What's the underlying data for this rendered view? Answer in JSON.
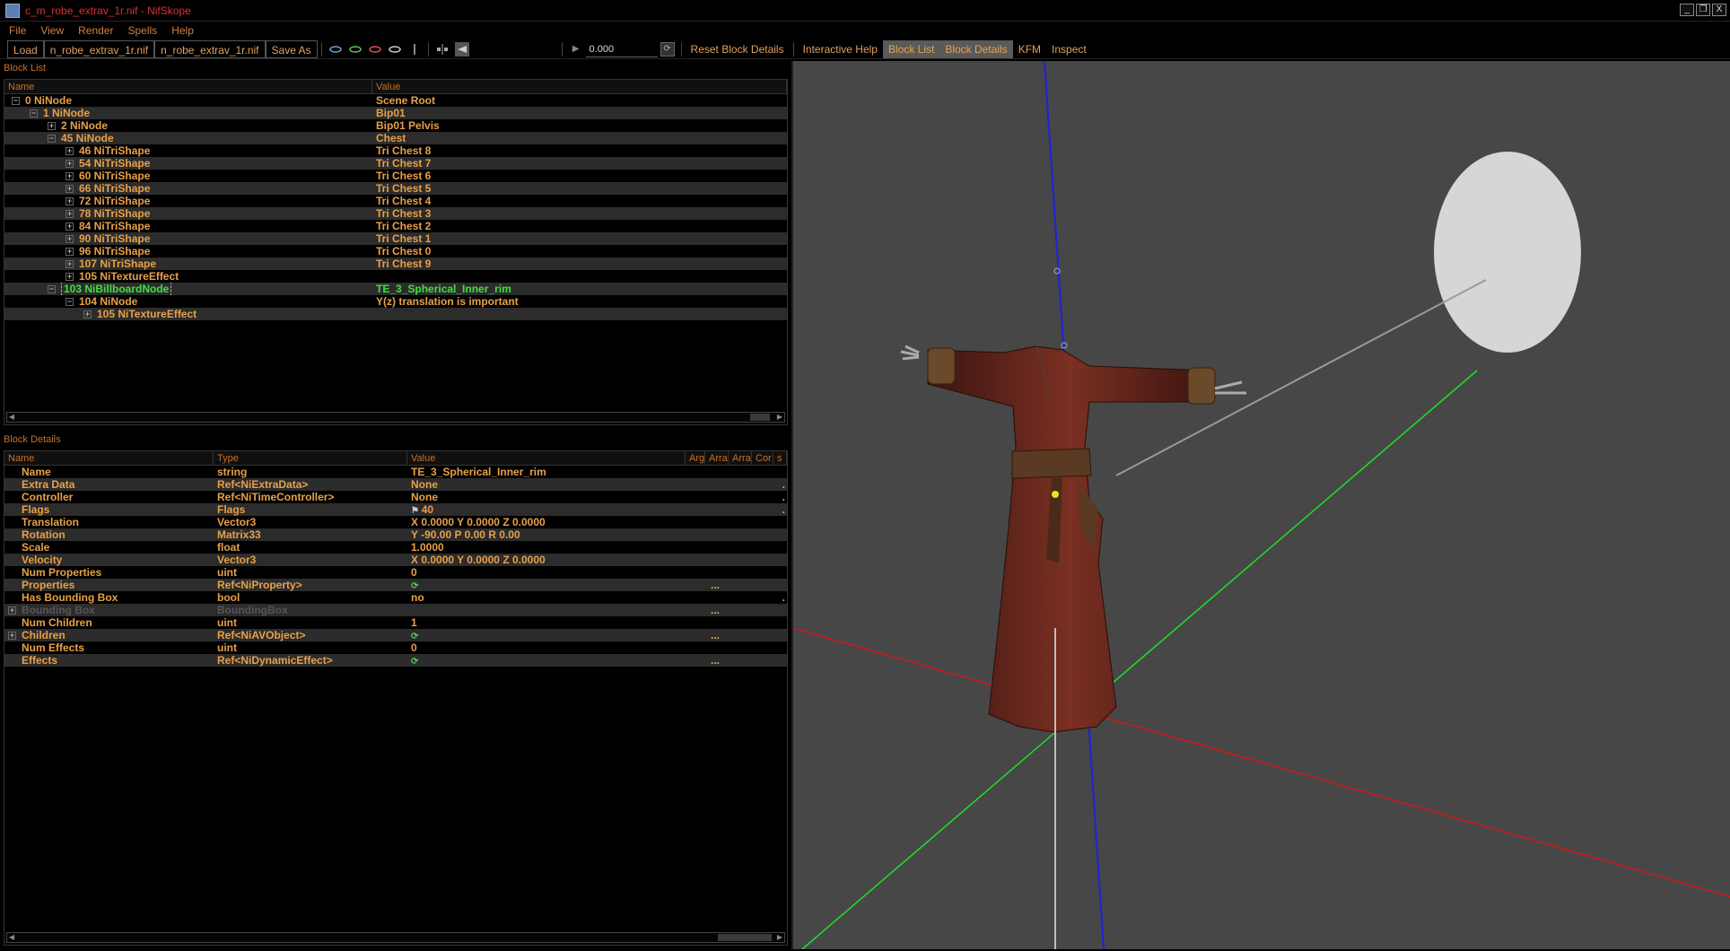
{
  "window": {
    "title": "c_m_robe_extrav_1r.nif - NifSkope",
    "min_label": "_",
    "max_label": "❐",
    "close_label": "X"
  },
  "menu": [
    "File",
    "View",
    "Render",
    "Spells",
    "Help"
  ],
  "toolbar": {
    "load": "Load",
    "load_file": "n_robe_extrav_1r.nif",
    "save_file": "n_robe_extrav_1r.nif",
    "save_as": "Save As",
    "time_value": "0.000",
    "reset_block_details": "Reset Block Details",
    "interactive_help": "Interactive Help",
    "block_list": "Block List",
    "block_details": "Block Details",
    "kfm": "KFM",
    "inspect": "Inspect"
  },
  "block_list": {
    "title": "Block List",
    "col_name": "Name",
    "col_value": "Value",
    "rows": [
      {
        "name": "0 NiNode",
        "value": "Scene Root",
        "depth": 0,
        "exp": "−"
      },
      {
        "name": "1 NiNode",
        "value": "Bip01",
        "depth": 1,
        "exp": "−"
      },
      {
        "name": "2 NiNode",
        "value": "Bip01 Pelvis",
        "depth": 2,
        "exp": "+"
      },
      {
        "name": "45 NiNode",
        "value": "Chest",
        "depth": 2,
        "exp": "−"
      },
      {
        "name": "46 NiTriShape",
        "value": "Tri Chest 8",
        "depth": 3,
        "exp": "+"
      },
      {
        "name": "54 NiTriShape",
        "value": "Tri Chest 7",
        "depth": 3,
        "exp": "+"
      },
      {
        "name": "60 NiTriShape",
        "value": "Tri Chest 6",
        "depth": 3,
        "exp": "+"
      },
      {
        "name": "66 NiTriShape",
        "value": "Tri Chest 5",
        "depth": 3,
        "exp": "+"
      },
      {
        "name": "72 NiTriShape",
        "value": "Tri Chest 4",
        "depth": 3,
        "exp": "+"
      },
      {
        "name": "78 NiTriShape",
        "value": "Tri Chest 3",
        "depth": 3,
        "exp": "+"
      },
      {
        "name": "84 NiTriShape",
        "value": "Tri Chest 2",
        "depth": 3,
        "exp": "+"
      },
      {
        "name": "90 NiTriShape",
        "value": "Tri Chest 1",
        "depth": 3,
        "exp": "+"
      },
      {
        "name": "96 NiTriShape",
        "value": "Tri Chest 0",
        "depth": 3,
        "exp": "+"
      },
      {
        "name": "107 NiTriShape",
        "value": "Tri Chest 9",
        "depth": 3,
        "exp": "+"
      },
      {
        "name": "105 NiTextureEffect",
        "value": "",
        "depth": 3,
        "exp": "+"
      },
      {
        "name": "103 NiBillboardNode",
        "value": "TE_3_Spherical_Inner_rim",
        "depth": 2,
        "exp": "−",
        "selected": true
      },
      {
        "name": "104 NiNode",
        "value": "Y(z) translation is important",
        "depth": 3,
        "exp": "−"
      },
      {
        "name": "105 NiTextureEffect",
        "value": "",
        "depth": 4,
        "exp": "+"
      }
    ]
  },
  "block_details": {
    "title": "Block Details",
    "col_name": "Name",
    "col_type": "Type",
    "col_value": "Value",
    "col_arg": "Argu",
    "col_arr1": "Arra",
    "col_arr2": "Arra",
    "col_cond": "Cor",
    "col_s": "s",
    "rows": [
      {
        "name": "Name",
        "type": "string",
        "value": "TE_3_Spherical_Inner_rim",
        "exp": "",
        "trail": ""
      },
      {
        "name": "Extra Data",
        "type": "Ref<NiExtraData>",
        "value": "None",
        "exp": "",
        "trail": "."
      },
      {
        "name": "Controller",
        "type": "Ref<NiTimeController>",
        "value": "None",
        "exp": "",
        "trail": "."
      },
      {
        "name": "Flags",
        "type": "Flags",
        "value": "40",
        "exp": "",
        "trail": ".",
        "flag_icon": true
      },
      {
        "name": "Translation",
        "type": "Vector3",
        "value": "X 0.0000 Y 0.0000 Z 0.0000",
        "exp": "",
        "trail": ""
      },
      {
        "name": "Rotation",
        "type": "Matrix33",
        "value": "Y -90.00 P 0.00 R 0.00",
        "exp": "",
        "trail": ""
      },
      {
        "name": "Scale",
        "type": "float",
        "value": "1.0000",
        "exp": "",
        "trail": ""
      },
      {
        "name": "Velocity",
        "type": "Vector3",
        "value": "X 0.0000 Y 0.0000 Z 0.0000",
        "exp": "",
        "trail": ""
      },
      {
        "name": "Num Properties",
        "type": "uint",
        "value": "0",
        "exp": "",
        "trail": ""
      },
      {
        "name": "Properties",
        "type": "Ref<NiProperty>",
        "value": "",
        "exp": "",
        "trail": "",
        "ref_icon": true,
        "dots": "..."
      },
      {
        "name": "Has Bounding Box",
        "type": "bool",
        "value": "no",
        "exp": "",
        "trail": "."
      },
      {
        "name": "Bounding Box",
        "type": "BoundingBox",
        "value": "",
        "exp": "+",
        "trail": "",
        "grey": true,
        "dots": "..."
      },
      {
        "name": "Num Children",
        "type": "uint",
        "value": "1",
        "exp": "",
        "trail": ""
      },
      {
        "name": "Children",
        "type": "Ref<NiAVObject>",
        "value": "",
        "exp": "+",
        "trail": "",
        "ref_icon": true,
        "dots": "..."
      },
      {
        "name": "Num Effects",
        "type": "uint",
        "value": "0",
        "exp": "",
        "trail": ""
      },
      {
        "name": "Effects",
        "type": "Ref<NiDynamicEffect>",
        "value": "",
        "exp": "",
        "trail": "",
        "ref_icon": true,
        "dots": "..."
      }
    ]
  },
  "viewport": {
    "axis_x_color": "#d01818",
    "axis_y_color": "#20e020",
    "axis_z_color": "#2020e0",
    "background": "#474747"
  }
}
